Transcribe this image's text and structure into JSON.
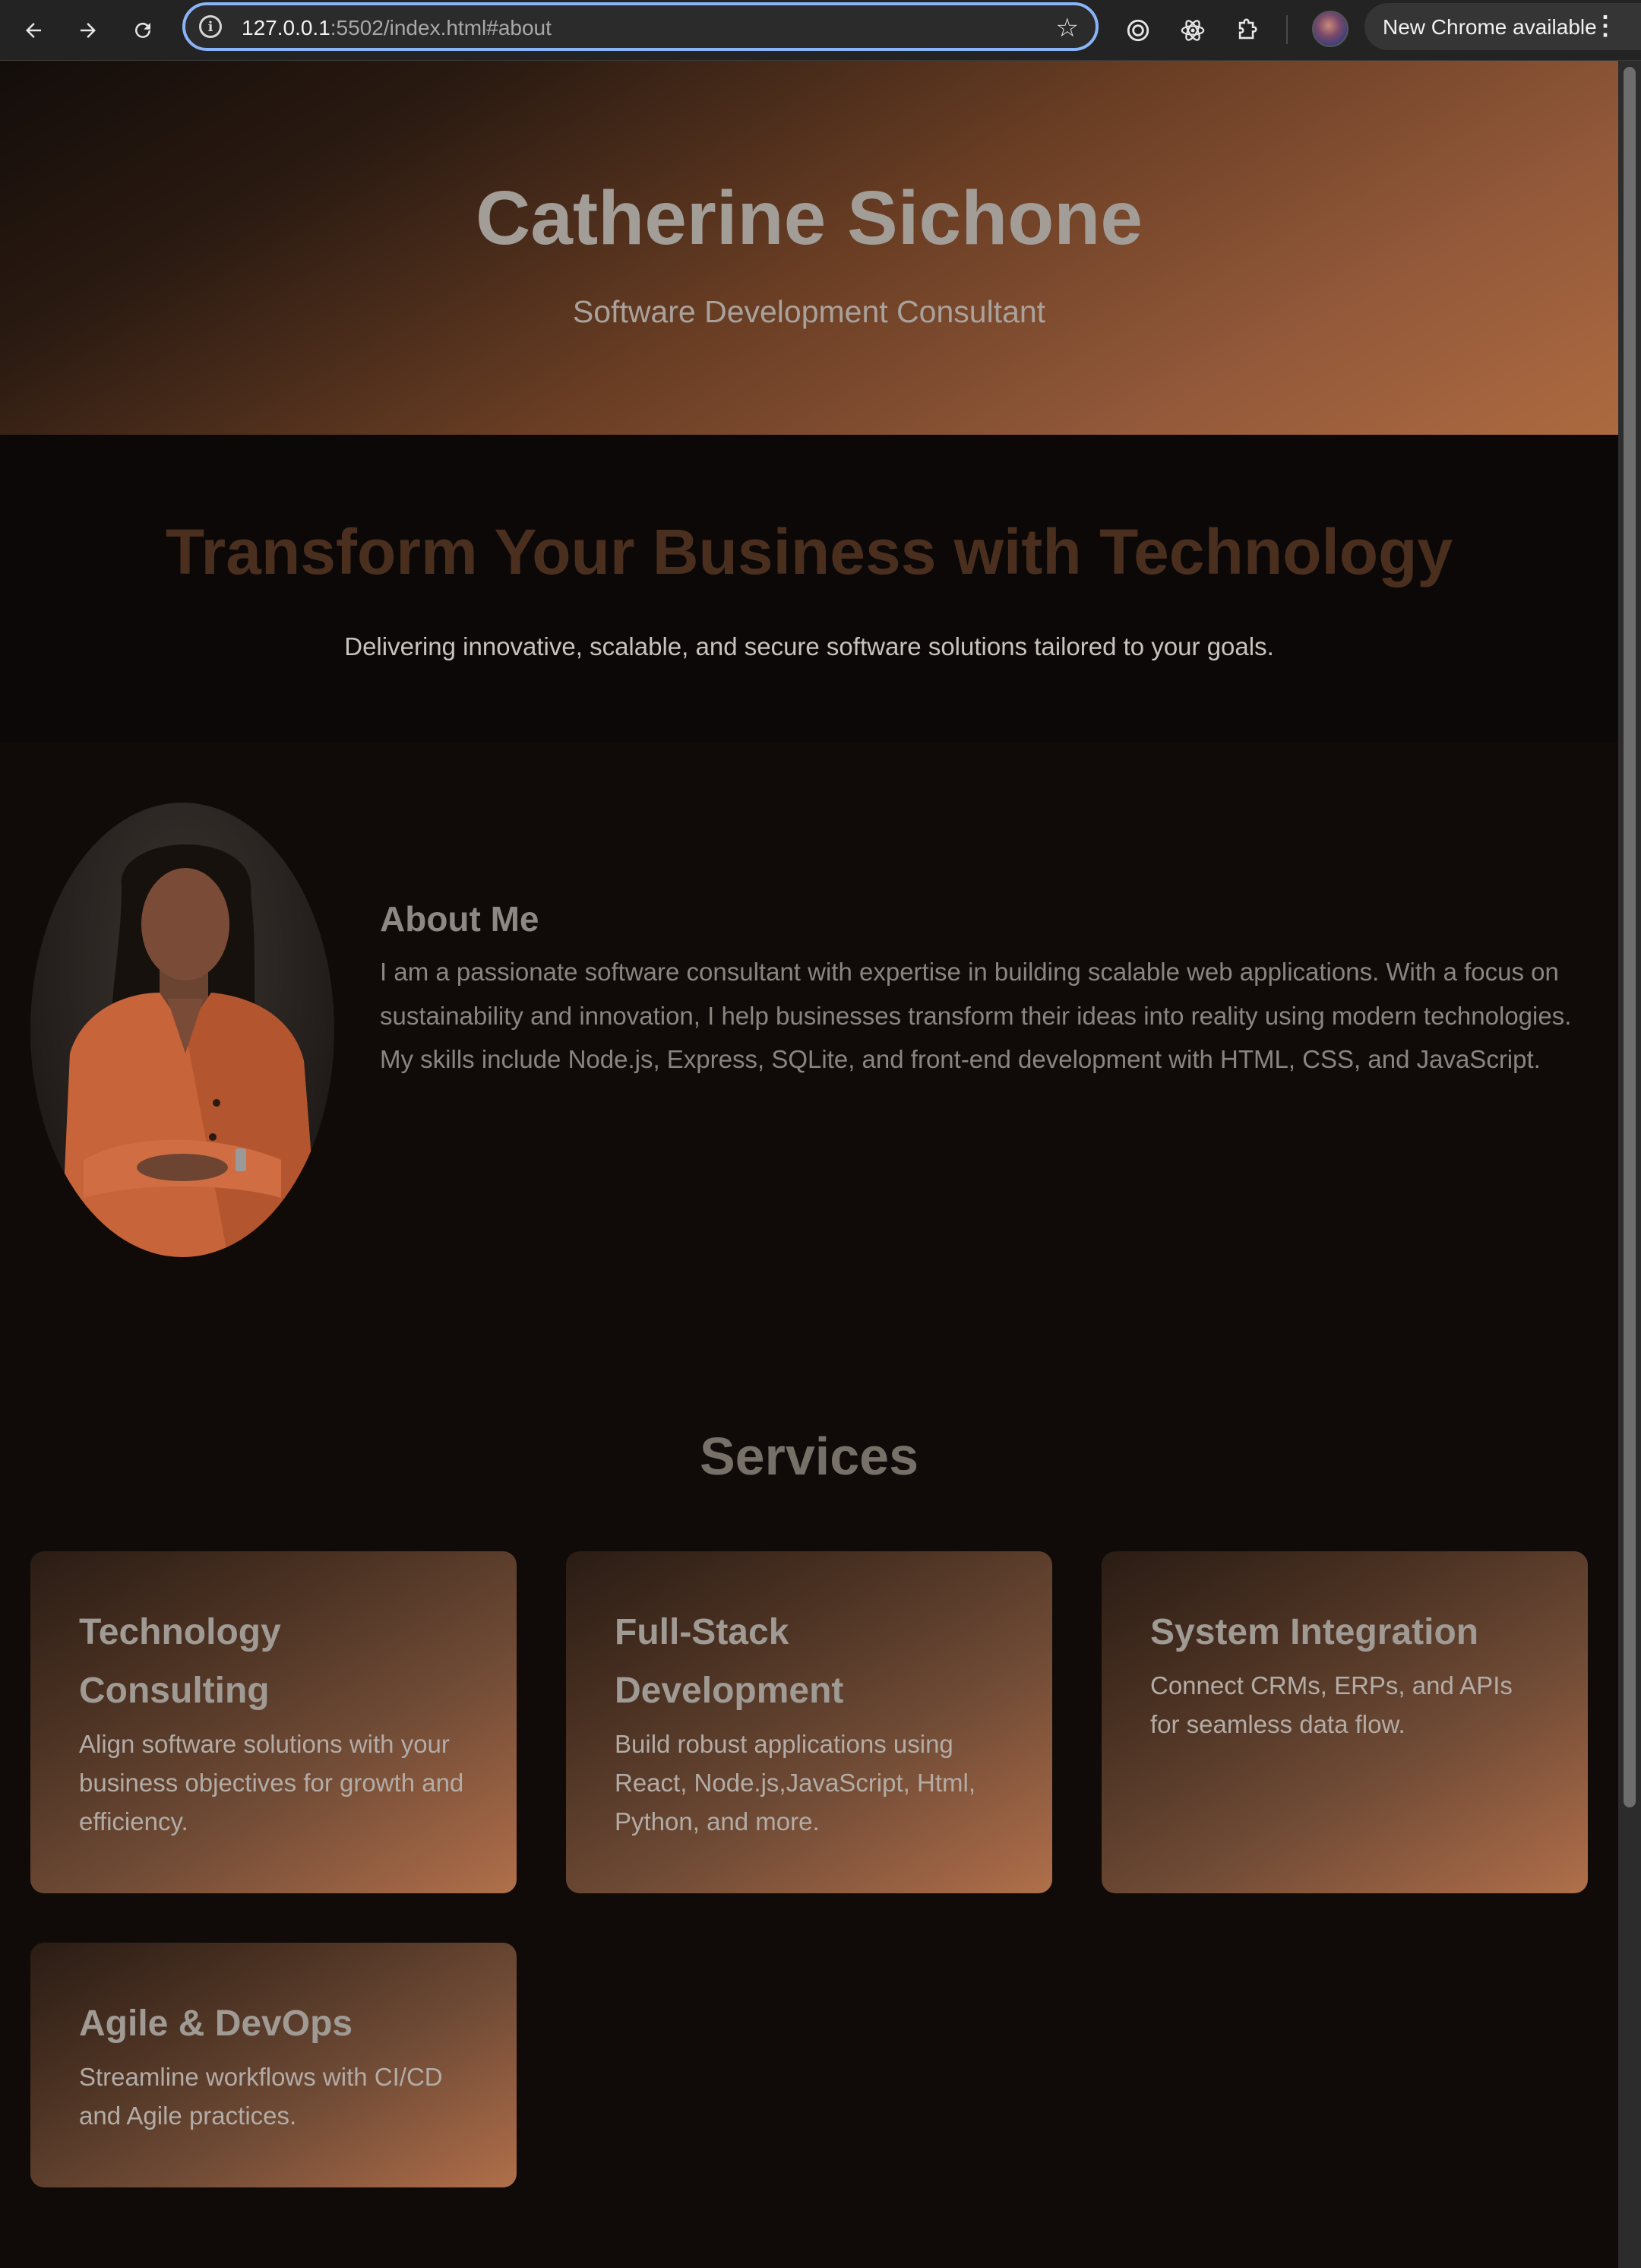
{
  "browser": {
    "url_host": "127.0.0.1",
    "url_rest": ":5502/index.html#about",
    "update_label": "New Chrome available",
    "icons": [
      "back-icon",
      "forward-icon",
      "reload-icon",
      "site-info-icon",
      "bookmark-star-icon",
      "extension-target-icon",
      "react-devtools-icon",
      "extensions-puzzle-icon",
      "profile-avatar",
      "more-vert-icon"
    ]
  },
  "hero": {
    "name": "Catherine Sichone",
    "subtitle": "Software Development Consultant"
  },
  "tagline": {
    "title": "Transform Your Business with Technology",
    "text": "Delivering innovative, scalable, and secure software solutions tailored to your goals."
  },
  "about": {
    "title": "About Me",
    "paragraph1": "I am a passionate software consultant with expertise in building scalable web applications. With a focus on sustainability and innovation, I help businesses transform their ideas into reality using modern technologies.",
    "paragraph2": "My skills include Node.js, Express, SQLite, and front-end development with HTML, CSS, and JavaScript."
  },
  "services": {
    "title": "Services",
    "items": [
      {
        "title": "Technology Consulting",
        "text": "Align software solutions with your business objectives for growth and efficiency."
      },
      {
        "title": "Full-Stack Development",
        "text": "Build robust applications using React, Node.js,JavaScript, Html, Python, and more."
      },
      {
        "title": "System Integration",
        "text": "Connect CRMs, ERPs, and APIs for seamless data flow."
      },
      {
        "title": "Agile & DevOps",
        "text": "Streamline workflows with CI/CD and Agile practices."
      }
    ]
  },
  "colors": {
    "accent": "#ad6a40",
    "background": "#100b08",
    "tagline_title": "#4a2f1f"
  }
}
